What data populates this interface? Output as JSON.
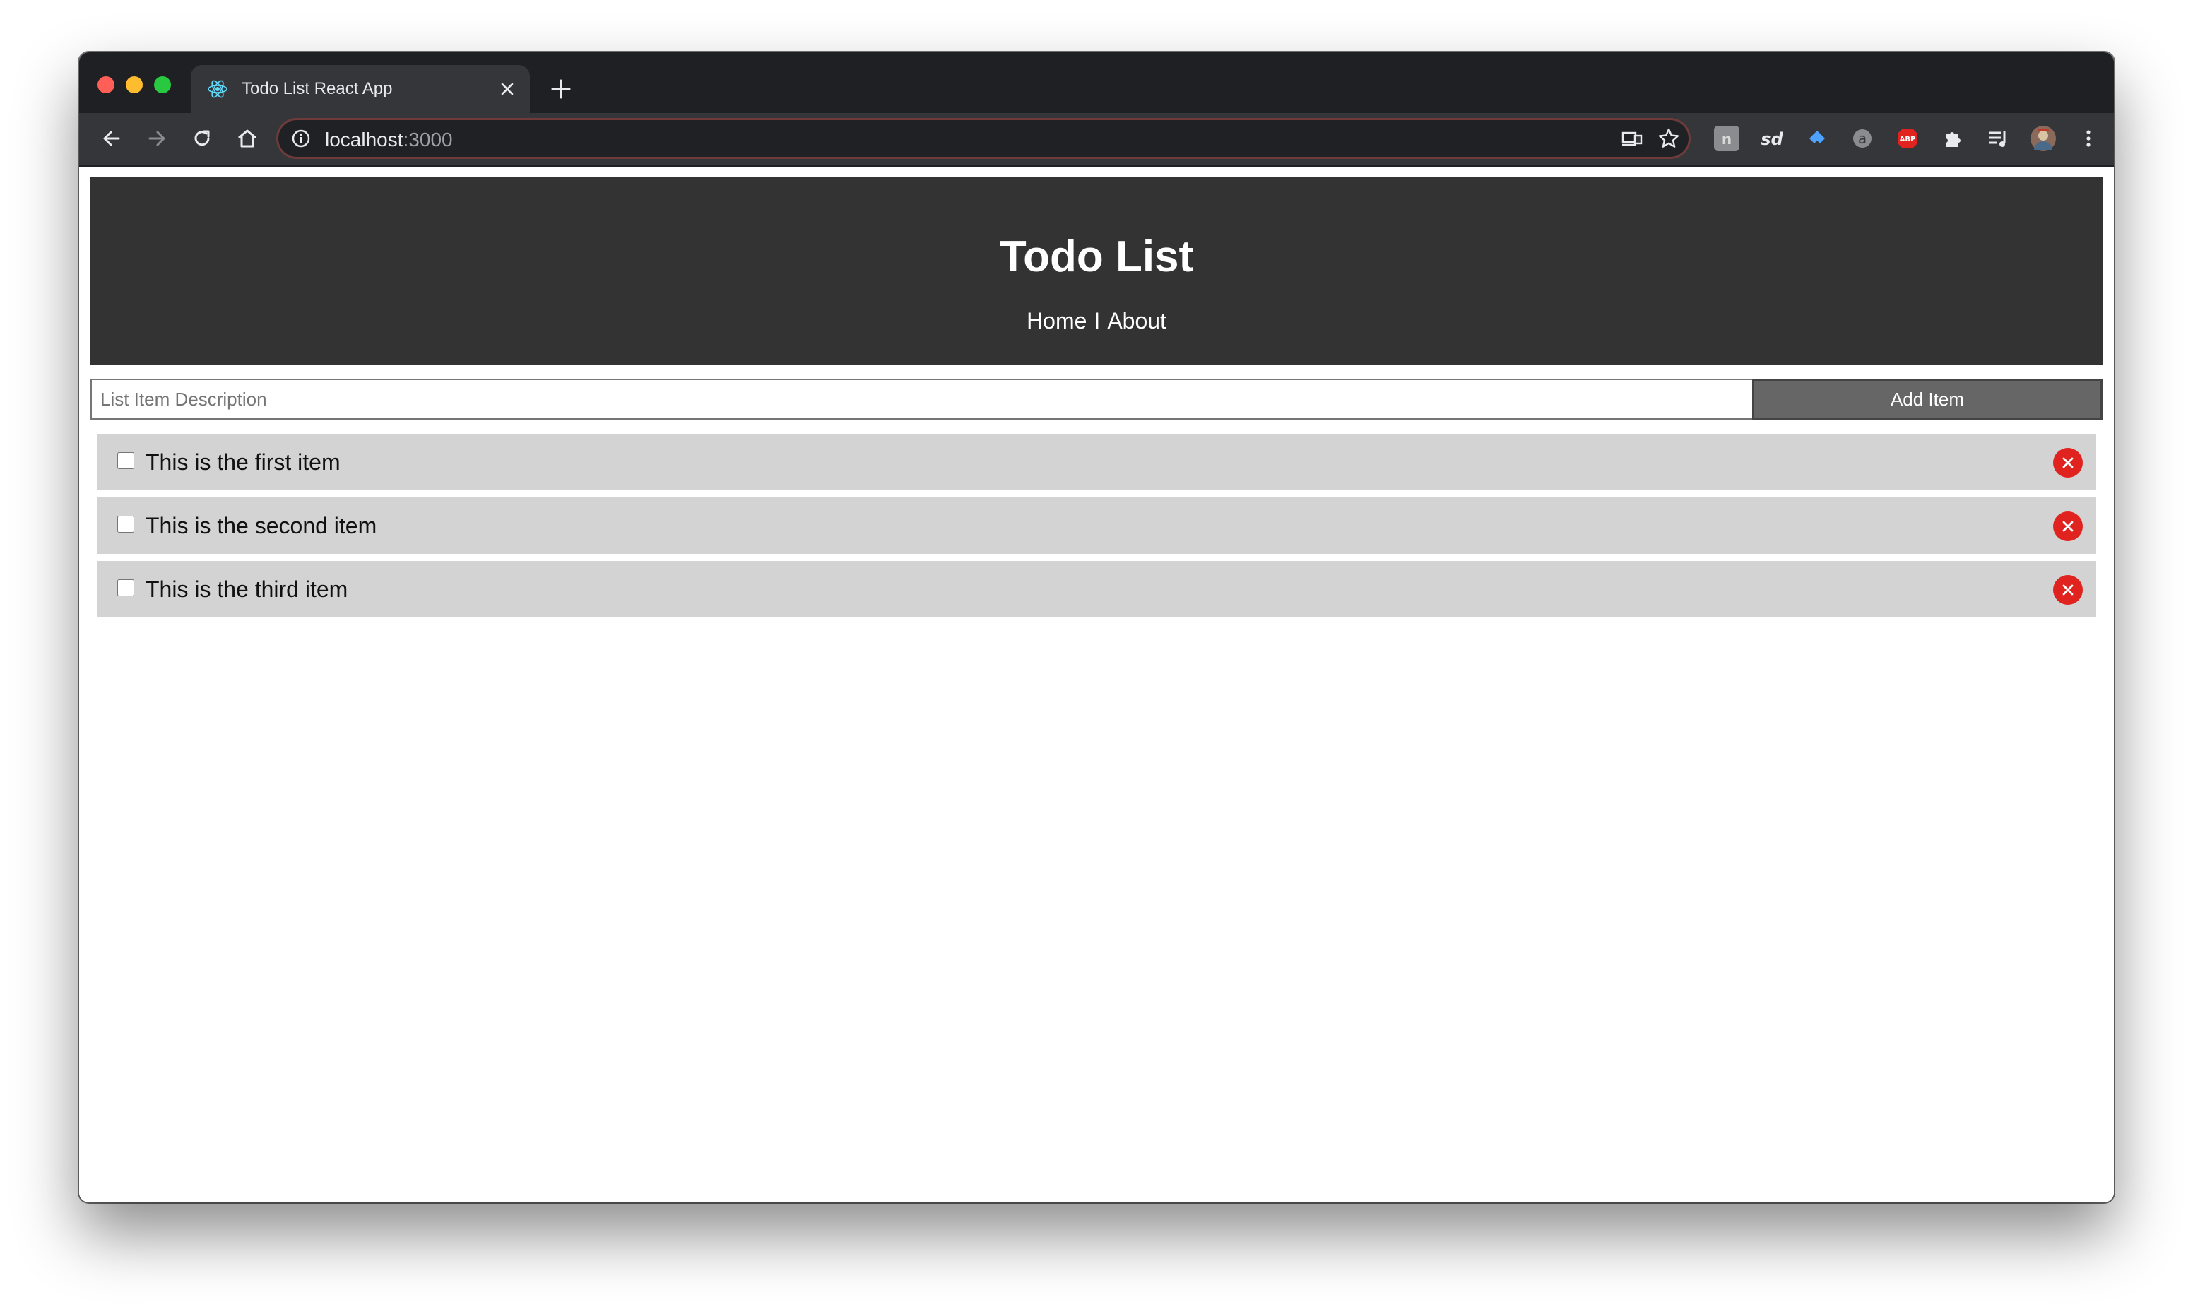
{
  "browser": {
    "tab_title": "Todo List React App",
    "url_host": "localhost",
    "url_port": ":3000"
  },
  "app": {
    "title": "Todo List",
    "nav": {
      "home": "Home",
      "separator": "I",
      "about": "About"
    },
    "form": {
      "placeholder": "List Item Description",
      "add_label": "Add Item"
    },
    "items": [
      {
        "label": "This is the first item",
        "checked": false
      },
      {
        "label": "This is the second item",
        "checked": false
      },
      {
        "label": "This is the third item",
        "checked": false
      }
    ]
  },
  "colors": {
    "header_bg": "#333333",
    "item_bg": "#d3d3d3",
    "add_button_bg": "#666666",
    "delete_red": "#e0231e"
  },
  "icons": [
    "react-favicon",
    "close-icon",
    "plus-icon",
    "back-arrow-icon",
    "forward-arrow-icon",
    "reload-icon",
    "home-icon",
    "info-icon",
    "cast-icon",
    "star-icon",
    "extensions-icon",
    "media-icon",
    "profile-avatar",
    "kebab-menu-icon",
    "delete-x-icon"
  ]
}
